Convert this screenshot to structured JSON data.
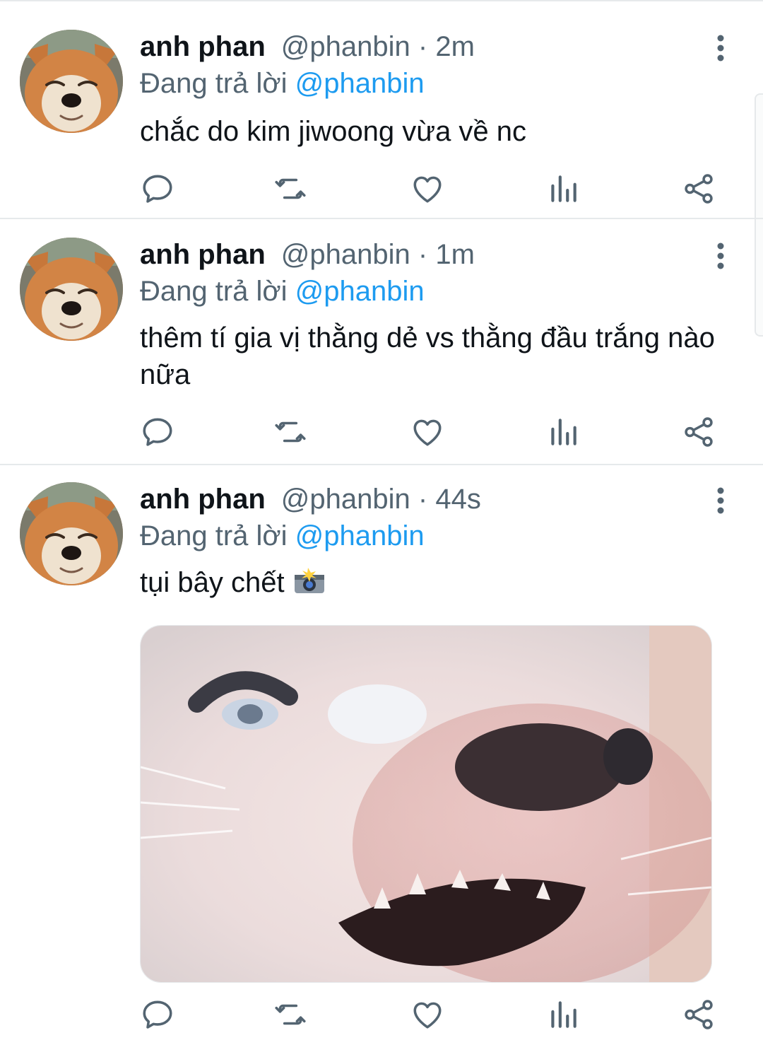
{
  "tweets": [
    {
      "name": "anh phan",
      "handle": "@phanbin",
      "separator": "·",
      "time": "2m",
      "reply_prefix": "Đang trả lời",
      "reply_to": "@phanbin",
      "text": "chắc do kim jiwoong vừa về nc"
    },
    {
      "name": "anh phan",
      "handle": "@phanbin",
      "separator": "·",
      "time": "1m",
      "reply_prefix": "Đang trả lời",
      "reply_to": "@phanbin",
      "text": "thêm tí gia vị thằng dẻ vs thằng đầu trắng nào nữa"
    },
    {
      "name": "anh phan",
      "handle": "@phanbin",
      "separator": "·",
      "time": "44s",
      "reply_prefix": "Đang trả lời",
      "reply_to": "@phanbin",
      "text": "tụi bây chết",
      "emoji": "camera-flash-emoji",
      "has_media": true
    }
  ],
  "action_icons": [
    "reply-icon",
    "retweet-icon",
    "like-icon",
    "analytics-icon",
    "share-icon"
  ],
  "colors": {
    "accent": "#1d9bf0",
    "secondary_text": "#536471",
    "primary_text": "#0f1419",
    "divider": "#e6e9eb"
  }
}
